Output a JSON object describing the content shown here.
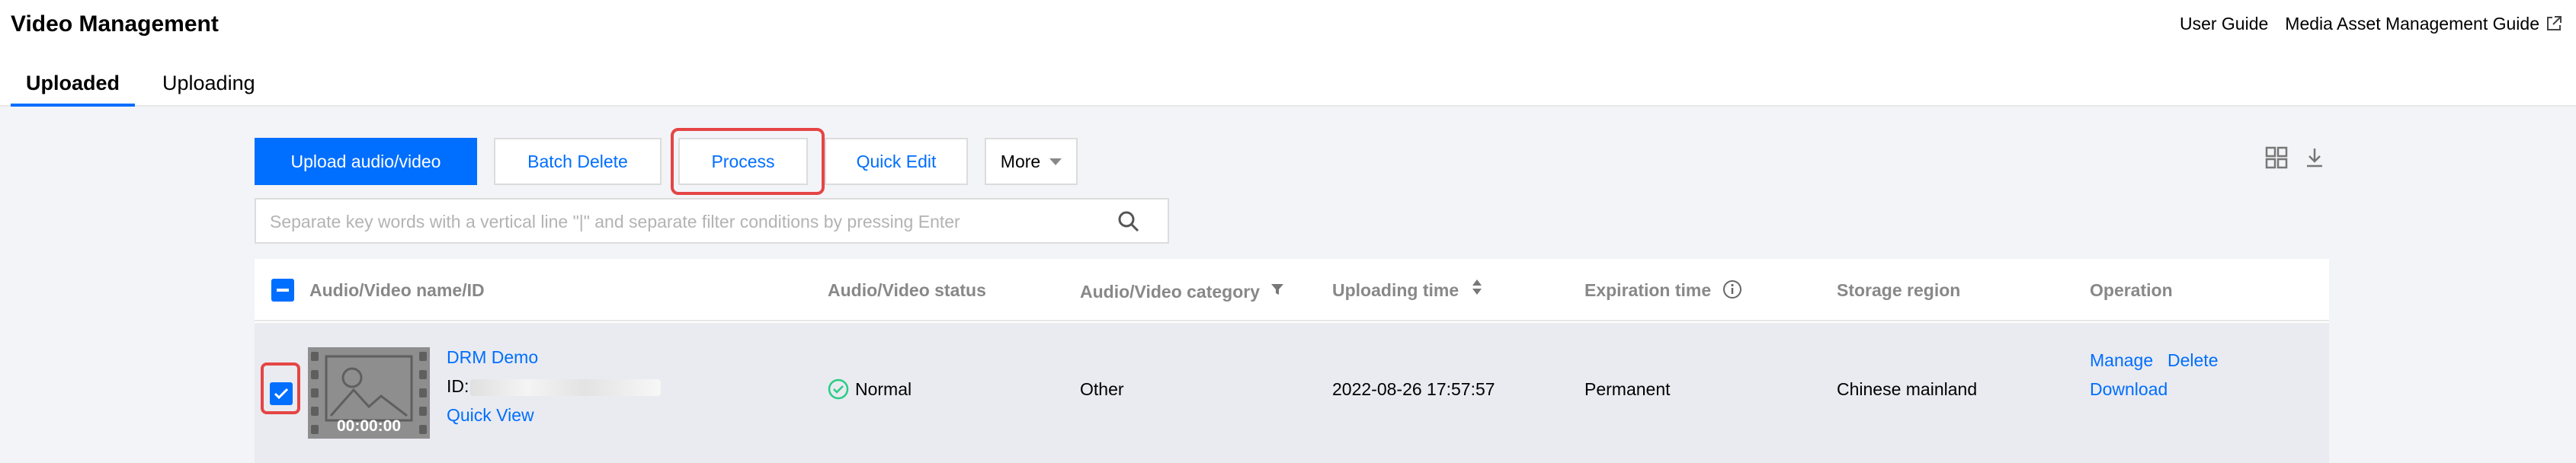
{
  "header": {
    "title": "Video Management",
    "links": [
      "User Guide",
      "Media Asset Management Guide"
    ]
  },
  "tabs": [
    {
      "label": "Uploaded",
      "active": true
    },
    {
      "label": "Uploading",
      "active": false
    }
  ],
  "toolbar": {
    "upload_label": "Upload audio/video",
    "batch_delete_label": "Batch Delete",
    "process_label": "Process",
    "quick_edit_label": "Quick Edit",
    "more_label": "More"
  },
  "search": {
    "placeholder": "Separate key words with a vertical line \"|\" and separate filter conditions by pressing Enter"
  },
  "table": {
    "columns": [
      "Audio/Video name/ID",
      "Audio/Video status",
      "Audio/Video category",
      "Uploading time",
      "Expiration time",
      "Storage region",
      "Operation"
    ],
    "rows": [
      {
        "name": "DRM Demo",
        "id_prefix": "ID:",
        "quick_view": "Quick View",
        "duration": "00:00:00",
        "status": "Normal",
        "category": "Other",
        "uploading_time": "2022-08-26 17:57:57",
        "expiration": "Permanent",
        "region": "Chinese mainland",
        "operations": [
          "Manage",
          "Delete",
          "Download"
        ],
        "checked": true
      }
    ]
  },
  "colors": {
    "primary": "#006eff",
    "highlight_frame": "#e54545",
    "status_ok": "#29cc85"
  }
}
